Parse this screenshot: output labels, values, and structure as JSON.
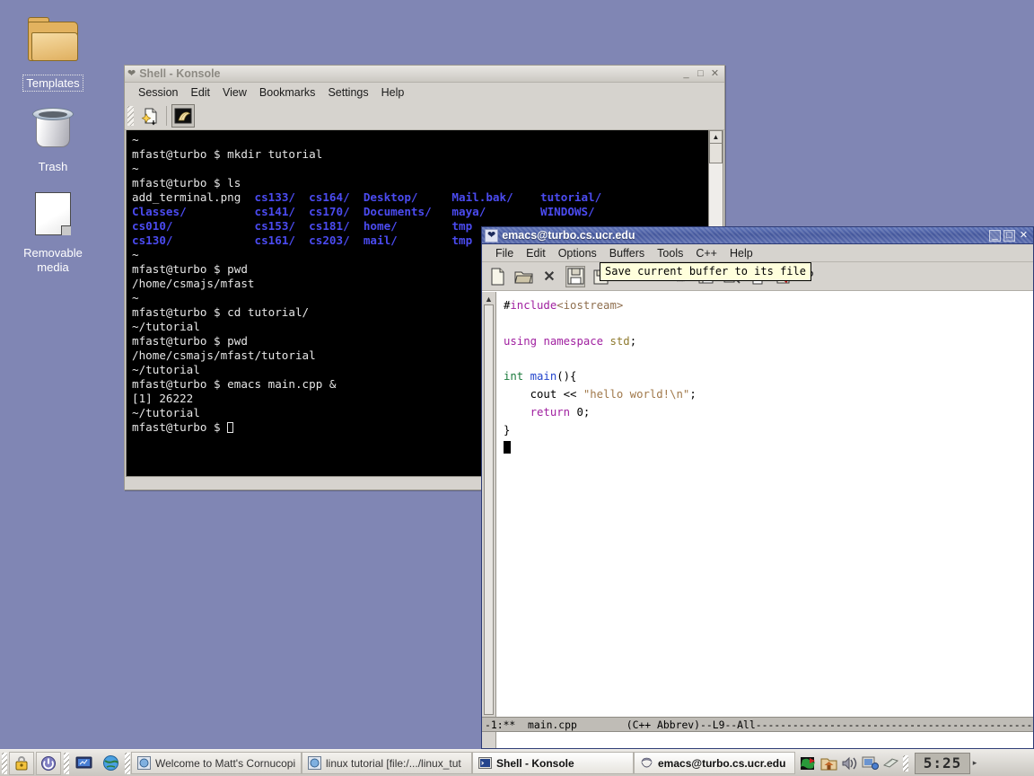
{
  "desktop": {
    "background_color": "#8086b4",
    "icons": [
      {
        "label": "Templates",
        "icon": "folder-icon",
        "selected": true
      },
      {
        "label": "Trash",
        "icon": "trash-icon",
        "selected": false
      },
      {
        "label": "Removable media",
        "label_line1": "Removable",
        "label_line2": "media",
        "icon": "removable-media-icon",
        "selected": false
      }
    ]
  },
  "konsole": {
    "title": "Shell - Konsole",
    "active": false,
    "window_buttons": {
      "minimize": "_",
      "maximize": "□",
      "close": "✕"
    },
    "menu": [
      "Session",
      "Edit",
      "View",
      "Bookmarks",
      "Settings",
      "Help"
    ],
    "toolbar": [
      {
        "name": "new-session-icon",
        "glyph": "✦"
      },
      {
        "name": "shell-session-icon",
        "glyph": "🐚"
      }
    ],
    "terminal": {
      "prompt": "mfast@turbo $",
      "lines": [
        {
          "type": "tilde",
          "text": "~"
        },
        {
          "type": "cmd",
          "text": "mfast@turbo $ mkdir tutorial"
        },
        {
          "type": "tilde",
          "text": "~"
        },
        {
          "type": "cmd",
          "text": "mfast@turbo $ ls"
        },
        {
          "type": "ls",
          "cols": [
            {
              "text": "add_terminal.png",
              "dir": false
            },
            {
              "text": "cs133/",
              "dir": true
            },
            {
              "text": "cs164/",
              "dir": true
            },
            {
              "text": "Desktop/",
              "dir": true
            },
            {
              "text": "Mail.bak/",
              "dir": true
            },
            {
              "text": "tutorial/",
              "dir": true
            }
          ]
        },
        {
          "type": "ls",
          "cols": [
            {
              "text": "Classes/",
              "dir": true
            },
            {
              "text": "cs141/",
              "dir": true
            },
            {
              "text": "cs170/",
              "dir": true
            },
            {
              "text": "Documents/",
              "dir": true
            },
            {
              "text": "maya/",
              "dir": true
            },
            {
              "text": "WINDOWS/",
              "dir": true
            }
          ]
        },
        {
          "type": "ls",
          "cols": [
            {
              "text": "cs010/",
              "dir": true
            },
            {
              "text": "cs153/",
              "dir": true
            },
            {
              "text": "cs181/",
              "dir": true
            },
            {
              "text": "home/",
              "dir": true
            },
            {
              "text": "tmp",
              "dir": true
            },
            {
              "text": "",
              "dir": false
            }
          ]
        },
        {
          "type": "ls",
          "cols": [
            {
              "text": "cs130/",
              "dir": true
            },
            {
              "text": "cs161/",
              "dir": true
            },
            {
              "text": "cs203/",
              "dir": true
            },
            {
              "text": "mail/",
              "dir": true
            },
            {
              "text": "tmp",
              "dir": true
            },
            {
              "text": "",
              "dir": false
            }
          ]
        },
        {
          "type": "tilde",
          "text": "~"
        },
        {
          "type": "cmd",
          "text": "mfast@turbo $ pwd"
        },
        {
          "type": "out",
          "text": "/home/csmajs/mfast"
        },
        {
          "type": "tilde",
          "text": "~"
        },
        {
          "type": "cmd",
          "text": "mfast@turbo $ cd tutorial/"
        },
        {
          "type": "out",
          "text": "~/tutorial"
        },
        {
          "type": "cmd",
          "text": "mfast@turbo $ pwd"
        },
        {
          "type": "out",
          "text": "/home/csmajs/mfast/tutorial"
        },
        {
          "type": "out",
          "text": "~/tutorial"
        },
        {
          "type": "cmd",
          "text": "mfast@turbo $ emacs main.cpp &"
        },
        {
          "type": "out",
          "text": "[1] 26222"
        },
        {
          "type": "out",
          "text": "~/tutorial"
        },
        {
          "type": "prompt",
          "text": "mfast@turbo $ "
        }
      ]
    }
  },
  "emacs": {
    "title": "emacs@turbo.cs.ucr.edu",
    "active": true,
    "window_buttons": {
      "minimize": "_",
      "maximize": "□",
      "close": "✕"
    },
    "menu": [
      "File",
      "Edit",
      "Options",
      "Buffers",
      "Tools",
      "C++",
      "Help"
    ],
    "toolbar": [
      {
        "name": "new-file-icon",
        "glyph": "🗋",
        "state": "normal"
      },
      {
        "name": "open-folder-icon",
        "glyph": "🗁",
        "state": "normal"
      },
      {
        "name": "close-buffer-icon",
        "glyph": "✖",
        "state": "normal"
      },
      {
        "name": "save-icon",
        "glyph": "🖫",
        "state": "pressed"
      },
      {
        "name": "save-as-icon",
        "glyph": "🖫",
        "state": "normal"
      },
      {
        "name": "undo-icon",
        "glyph": "↶",
        "state": "normal"
      },
      {
        "name": "cut-icon",
        "glyph": "✄",
        "state": "disabled"
      },
      {
        "name": "copy-icon",
        "glyph": "⎘",
        "state": "disabled"
      },
      {
        "name": "paste-icon",
        "glyph": "📋",
        "state": "normal"
      },
      {
        "name": "search-icon",
        "glyph": "🔍",
        "state": "normal"
      },
      {
        "name": "print-icon",
        "glyph": "🖨",
        "state": "normal"
      },
      {
        "name": "spellcheck-icon",
        "glyph": "📝",
        "state": "normal"
      },
      {
        "name": "help-icon",
        "glyph": "?",
        "state": "normal"
      }
    ],
    "tooltip": "Save current buffer to its file",
    "code_lines": [
      [
        {
          "t": "#",
          "c": "plain"
        },
        {
          "t": "include",
          "c": "pre"
        },
        {
          "t": "<iostream>",
          "c": "inc"
        }
      ],
      [],
      [
        {
          "t": "using",
          "c": "kw"
        },
        {
          "t": " ",
          "c": "plain"
        },
        {
          "t": "namespace",
          "c": "kw"
        },
        {
          "t": " ",
          "c": "plain"
        },
        {
          "t": "std",
          "c": "var"
        },
        {
          "t": ";",
          "c": "plain"
        }
      ],
      [],
      [
        {
          "t": "int",
          "c": "type"
        },
        {
          "t": " ",
          "c": "plain"
        },
        {
          "t": "main",
          "c": "fn"
        },
        {
          "t": "(){",
          "c": "plain"
        }
      ],
      [
        {
          "t": "    cout << ",
          "c": "plain"
        },
        {
          "t": "\"hello world!\\n\"",
          "c": "str"
        },
        {
          "t": ";",
          "c": "plain"
        }
      ],
      [
        {
          "t": "    ",
          "c": "plain"
        },
        {
          "t": "return",
          "c": "kw"
        },
        {
          "t": " 0;",
          "c": "plain"
        }
      ],
      [
        {
          "t": "}",
          "c": "plain"
        }
      ]
    ],
    "modeline": "-1:**  main.cpp        (C++ Abbrev)--L9--All--------------------------------------------------",
    "modeline_parts": {
      "left": "-1:**",
      "buffer": "main.cpp",
      "mode": "(C++ Abbrev)",
      "position": "--L9--All",
      "filler": "--------------------------------------------------------------"
    }
  },
  "taskbar": {
    "launchers": [
      {
        "name": "lock-screen-icon",
        "glyph": "🔒"
      },
      {
        "name": "logout-icon",
        "glyph": "⏻"
      },
      {
        "name": "show-desktop-icon",
        "glyph": "🖵"
      },
      {
        "name": "web-browser-icon",
        "glyph": "🌐"
      }
    ],
    "windows": [
      {
        "label": "Welcome to Matt's Cornucopi",
        "icon": "browser-window-icon",
        "active": false
      },
      {
        "label": "linux tutorial [file:/.../linux_tut",
        "icon": "browser-window-icon",
        "active": false
      },
      {
        "label": "Shell - Konsole",
        "icon": "konsole-icon",
        "active": false
      },
      {
        "label": "emacs@turbo.cs.ucr.edu",
        "icon": "emacs-icon",
        "active": true
      }
    ],
    "tray": [
      {
        "name": "klipper-icon",
        "glyph": "🗒"
      },
      {
        "name": "home-folder-icon",
        "glyph": "🏠"
      },
      {
        "name": "volume-icon",
        "glyph": "🔊"
      },
      {
        "name": "network-icon",
        "glyph": "🖧"
      },
      {
        "name": "notes-icon",
        "glyph": "📓"
      }
    ],
    "clock": "5:25",
    "expand_arrow": "▸"
  }
}
